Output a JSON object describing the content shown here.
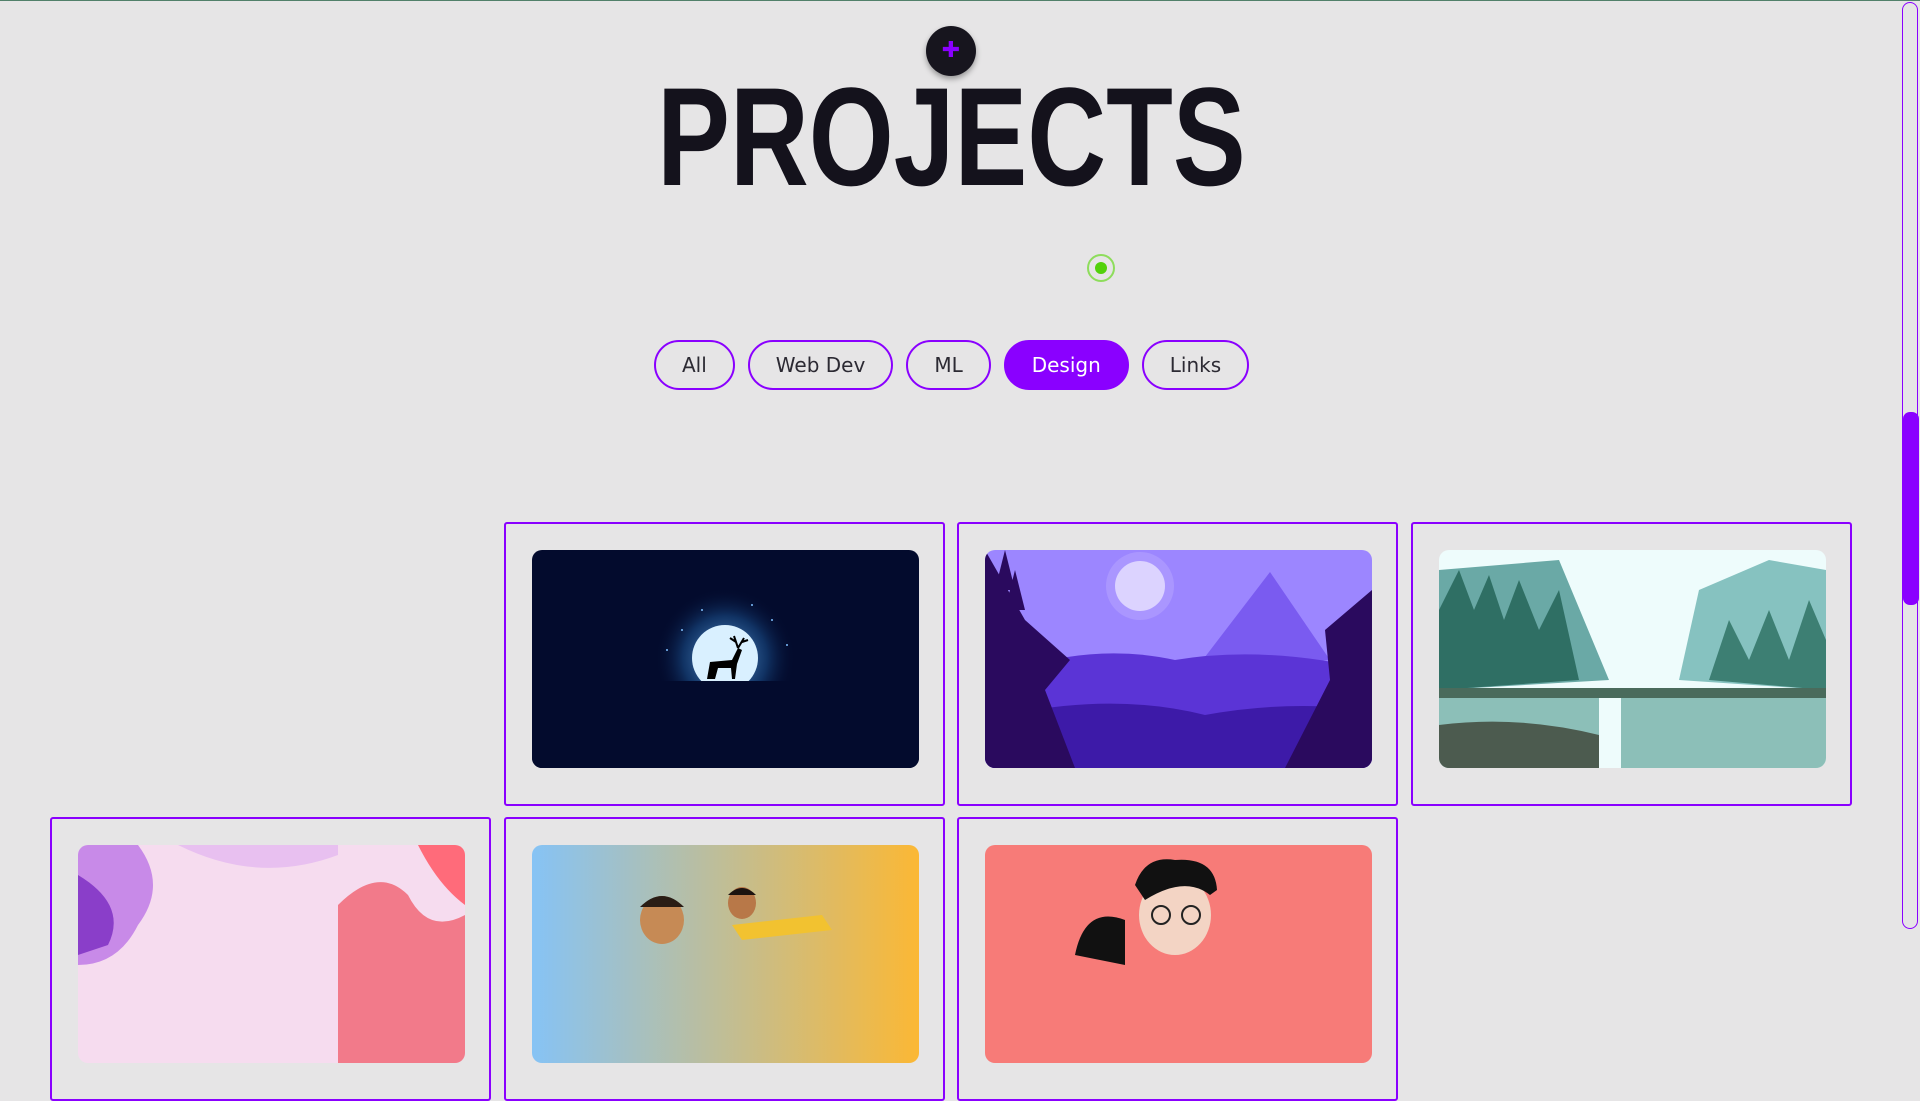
{
  "page": {
    "title": "PROJECTS"
  },
  "header": {
    "add_icon": "plus-icon"
  },
  "status": {
    "icon": "online-dot-icon",
    "color": "#52d10b"
  },
  "filters": [
    {
      "label": "All",
      "active": false
    },
    {
      "label": "Web Dev",
      "active": false
    },
    {
      "label": "ML",
      "active": false
    },
    {
      "label": "Design",
      "active": true
    },
    {
      "label": "Links",
      "active": false
    }
  ],
  "projects": [
    {
      "image": "night-deer-moon-illustration"
    },
    {
      "image": "purple-mountain-forest-illustration"
    },
    {
      "image": "teal-forest-waterfall-illustration"
    },
    {
      "image": "pastel-pink-waves-illustration"
    },
    {
      "image": "cartoon-characters-gradient-illustration"
    },
    {
      "image": "caricature-portrait-illustration"
    }
  ],
  "colors": {
    "accent": "#8a00ff",
    "background": "#e6e5e6",
    "text": "#14121c"
  }
}
